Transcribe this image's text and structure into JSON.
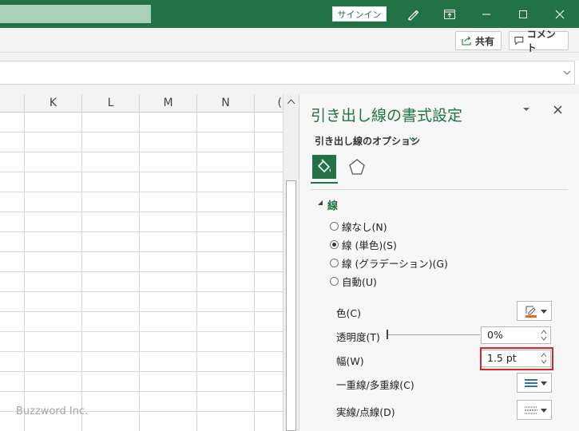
{
  "titlebar": {
    "signin_label": "サインイン",
    "icons": [
      "pen-icon",
      "ribbon-display-icon",
      "minimize-icon",
      "maximize-icon",
      "close-icon"
    ]
  },
  "ribbon": {
    "share_label": "共有",
    "comment_label": "コメント"
  },
  "grid": {
    "columns": [
      "K",
      "L",
      "M",
      "N",
      "("
    ],
    "row_count": 16
  },
  "watermark": "Buzzword Inc.",
  "pane": {
    "title": "引き出し線の書式設定",
    "options_label": "引き出し線のオプション",
    "tabs": [
      "fill-line-icon",
      "effects-icon"
    ],
    "section_label": "線",
    "radios": [
      {
        "label": "線なし(N)",
        "selected": false
      },
      {
        "label": "線 (単色)(S)",
        "selected": true
      },
      {
        "label": "線 (グラデーション)(G)",
        "selected": false
      },
      {
        "label": "自動(U)",
        "selected": false
      }
    ],
    "color_label": "色(C)",
    "transparency_label": "透明度(T)",
    "transparency_value": "0%",
    "width_label": "幅(W)",
    "width_value": "1.5 pt",
    "compound_label": "一重線/多重線(C)",
    "dash_label": "実線/点線(D)",
    "colors": {
      "accent": "#217346",
      "line_color_swatch": "#e46c29",
      "highlight": "#d9232d"
    }
  }
}
